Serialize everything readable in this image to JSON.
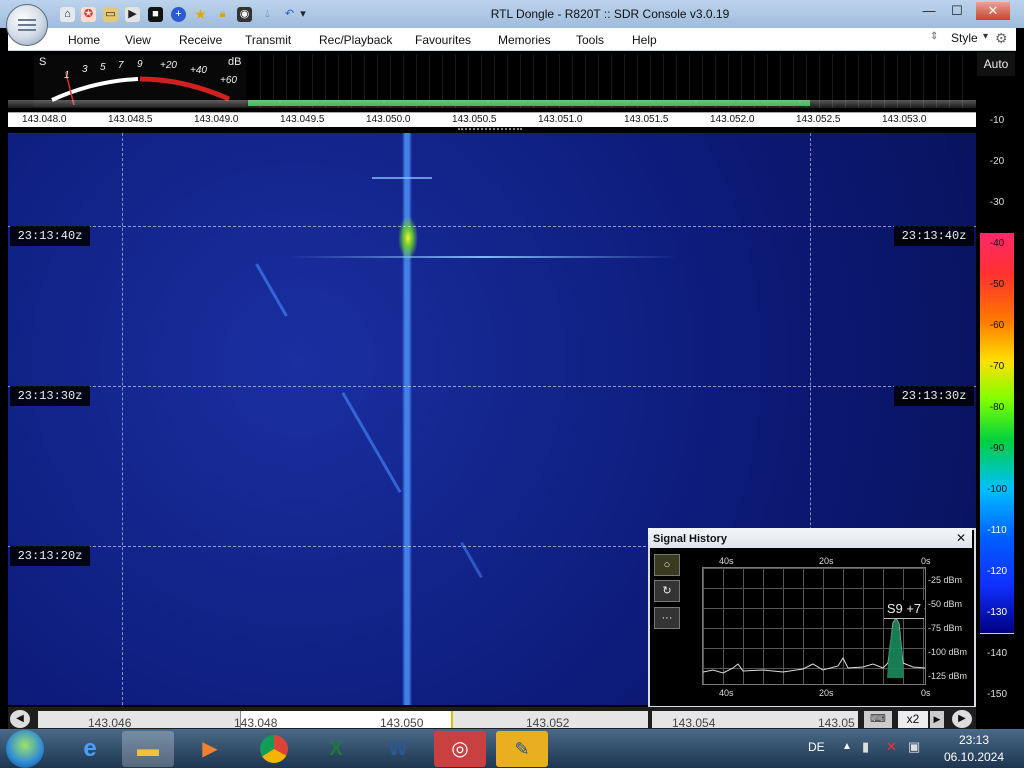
{
  "window": {
    "title": "RTL Dongle - R820T :: SDR Console v3.0.19"
  },
  "quick_access_icons": [
    "home-icon",
    "lifebuoy-icon",
    "folder-icon",
    "play-icon",
    "stop-icon",
    "plus-icon",
    "star-icon",
    "lock-icon",
    "camera-icon",
    "drop-icon",
    "undo-icon",
    "dropdown-icon"
  ],
  "menu": {
    "items": [
      "Home",
      "View",
      "Receive",
      "Transmit",
      "Rec/Playback",
      "Favourites",
      "Memories",
      "Tools",
      "Help"
    ],
    "style_label": "Style"
  },
  "smeter": {
    "s_label": "S",
    "db_label": "dB",
    "scale": [
      "1",
      "3",
      "5",
      "7",
      "9",
      "+20",
      "+40",
      "+60"
    ]
  },
  "frequency_scale": [
    "143.048.0",
    "143.048.5",
    "143.049.0",
    "143.049.5",
    "143.050.0",
    "143.050.5",
    "143.051.0",
    "143.051.5",
    "143.052.0",
    "143.052.5",
    "143.053.0"
  ],
  "waterfall": {
    "time_labels": [
      "23:13:40z",
      "23:13:30z",
      "23:13:20z"
    ]
  },
  "colorbar": {
    "auto_label": "Auto",
    "ticks": [
      "-10",
      "-20",
      "-30",
      "-40",
      "-50",
      "-60",
      "-70",
      "-80",
      "-90",
      "-100",
      "-110",
      "-120",
      "-130",
      "-140",
      "-150"
    ]
  },
  "signal_history": {
    "title": "Signal History",
    "close": "✕",
    "x_axis": [
      "40s",
      "20s",
      "0s"
    ],
    "y_axis": [
      "-25 dBm",
      "-50 dBm",
      "-75 dBm",
      "-100 dBm",
      "-125 dBm"
    ],
    "reading": "S9 +7",
    "buttons": [
      "○",
      "↻",
      "···"
    ]
  },
  "bottom_bar": {
    "ticks": [
      "143.046",
      "143.048",
      "143.050",
      "143.052",
      "143.054",
      "143.05"
    ],
    "zoom_label": "x2"
  },
  "taskbar": {
    "apps": [
      "internet-explorer-icon",
      "file-explorer-icon",
      "media-player-icon",
      "chrome-icon",
      "excel-icon",
      "word-icon",
      "sdr-console-icon",
      "notes-icon"
    ],
    "language": "DE",
    "time": "23:13",
    "date": "06.10.2024"
  },
  "colors": {
    "waterfall_bg": "#0c1a78",
    "accent_red": "#d02020",
    "signal_green": "#1fa83a"
  }
}
